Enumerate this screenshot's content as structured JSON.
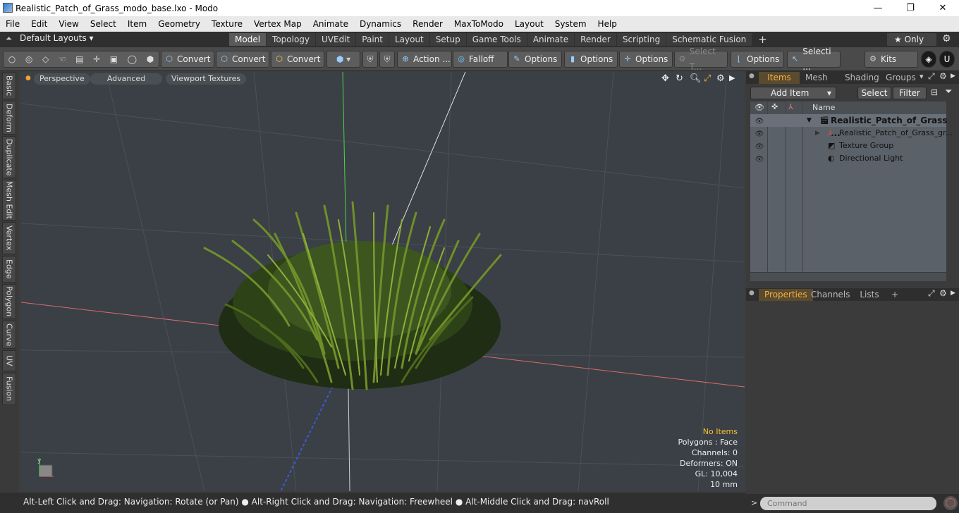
{
  "window": {
    "title": "Realistic_Patch_of_Grass_modo_base.lxo - Modo",
    "min": "—",
    "max": "❐",
    "close": "✕"
  },
  "menu": [
    "File",
    "Edit",
    "View",
    "Select",
    "Item",
    "Geometry",
    "Texture",
    "Vertex Map",
    "Animate",
    "Dynamics",
    "Render",
    "MaxToModo",
    "Layout",
    "System",
    "Help"
  ],
  "layouts": {
    "selector": "Default Layouts ▾",
    "tabs": [
      "Model",
      "Topology",
      "UVEdit",
      "Paint",
      "Layout",
      "Setup",
      "Game Tools",
      "Animate",
      "Render",
      "Scripting",
      "Schematic Fusion"
    ],
    "active": "Model",
    "add": "+",
    "only": "★  Only"
  },
  "toolbar": {
    "convert1": "Convert",
    "convert2": "Convert",
    "convert3": "Convert",
    "action": "Action  ...",
    "falloff": "Falloff",
    "options1": "Options",
    "options2": "Options",
    "options3": "Options",
    "select_t": "Select T...",
    "options4": "Options",
    "selecti": "Selecti ...",
    "kits": "Kits"
  },
  "left_tabs": [
    "Basic",
    "Deform",
    "Duplicate",
    "Mesh Edit",
    "Vertex",
    "Edge",
    "Polygon",
    "Curve",
    "UV",
    "Fusion"
  ],
  "viewport": {
    "perspective": "Perspective",
    "advanced": "Advanced",
    "textures": "Viewport Textures",
    "hud": {
      "no_items": "No Items",
      "polygons": "Polygons : Face",
      "channels": "Channels: 0",
      "deformers": "Deformers: ON",
      "gl": "GL: 10,004",
      "scale": "10 mm"
    },
    "axis_label": "y"
  },
  "status": "Alt-Left Click and Drag: Navigation: Rotate (or Pan) ● Alt-Right Click and Drag: Navigation: Freewheel ● Alt-Middle Click and Drag: navRoll",
  "items_panel": {
    "tabs": [
      "Items",
      "Mesh ...",
      "Shading",
      "Groups"
    ],
    "add_item": "Add Item",
    "select": "Select",
    "filter": "Filter",
    "col_name": "Name",
    "rows": [
      "Realistic_Patch_of_Grass ...",
      "Realistic_Patch_of_Grass_gr...",
      "Texture Group",
      "Directional Light"
    ]
  },
  "props_panel": {
    "tabs": [
      "Properties",
      "Channels",
      "Lists"
    ],
    "add": "+"
  },
  "command": {
    "placeholder": "Command",
    "prompt": ">"
  }
}
